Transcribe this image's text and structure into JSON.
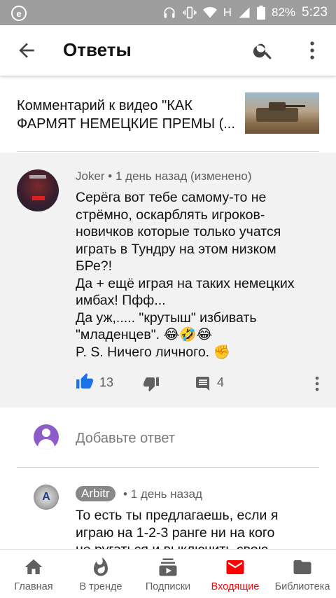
{
  "status_bar": {
    "network": "H",
    "battery": "82%",
    "time": "5:23"
  },
  "app_bar": {
    "title": "Ответы"
  },
  "video": {
    "text": "Комментарий к видео \"КАК ФАРМЯТ НЕМЕЦКИЕ ПРЕМЫ (..."
  },
  "comment": {
    "author": "Joker",
    "meta_sep": " • ",
    "time": "1 день назад (изменено)",
    "lines": [
      "Серёга вот тебе самому-то не",
      "стрёмно, оскарблять игроков-",
      "новичков которые только учатся",
      "играть в Тундру на этом низком",
      "БРе?!",
      "Да + ещё играя на таких немецких",
      "имбах! Пфф...",
      "Да уж,..... \"крутыш\" избивать",
      "\"младенцев\". 😂🤣😂",
      "P. S. Ничего личного. ✊"
    ],
    "likes": "13",
    "replies": "4"
  },
  "add_reply": {
    "placeholder": "Добавьте ответ"
  },
  "reply": {
    "author": "Arbitr",
    "time": "• 1 день назад",
    "avatar_letter": "A",
    "lines": [
      "То есть ты предлагаешь, если я",
      "играю на 1-2-3 ранге ни на кого",
      "не ругаться и выключить свою"
    ]
  },
  "bottom_nav": [
    {
      "label": "Главная",
      "icon": "home-icon",
      "active": false
    },
    {
      "label": "В тренде",
      "icon": "fire-icon",
      "active": false
    },
    {
      "label": "Подписки",
      "icon": "subscriptions-icon",
      "active": false
    },
    {
      "label": "Входящие",
      "icon": "inbox-mail-icon",
      "active": true
    },
    {
      "label": "Библиотека",
      "icon": "folder-icon",
      "active": false
    }
  ],
  "colors": {
    "accent": "#ff0000",
    "like_blue": "#1a73e8",
    "status_bar": "#9e9e9e",
    "comment_bg": "#f2f2f2"
  }
}
